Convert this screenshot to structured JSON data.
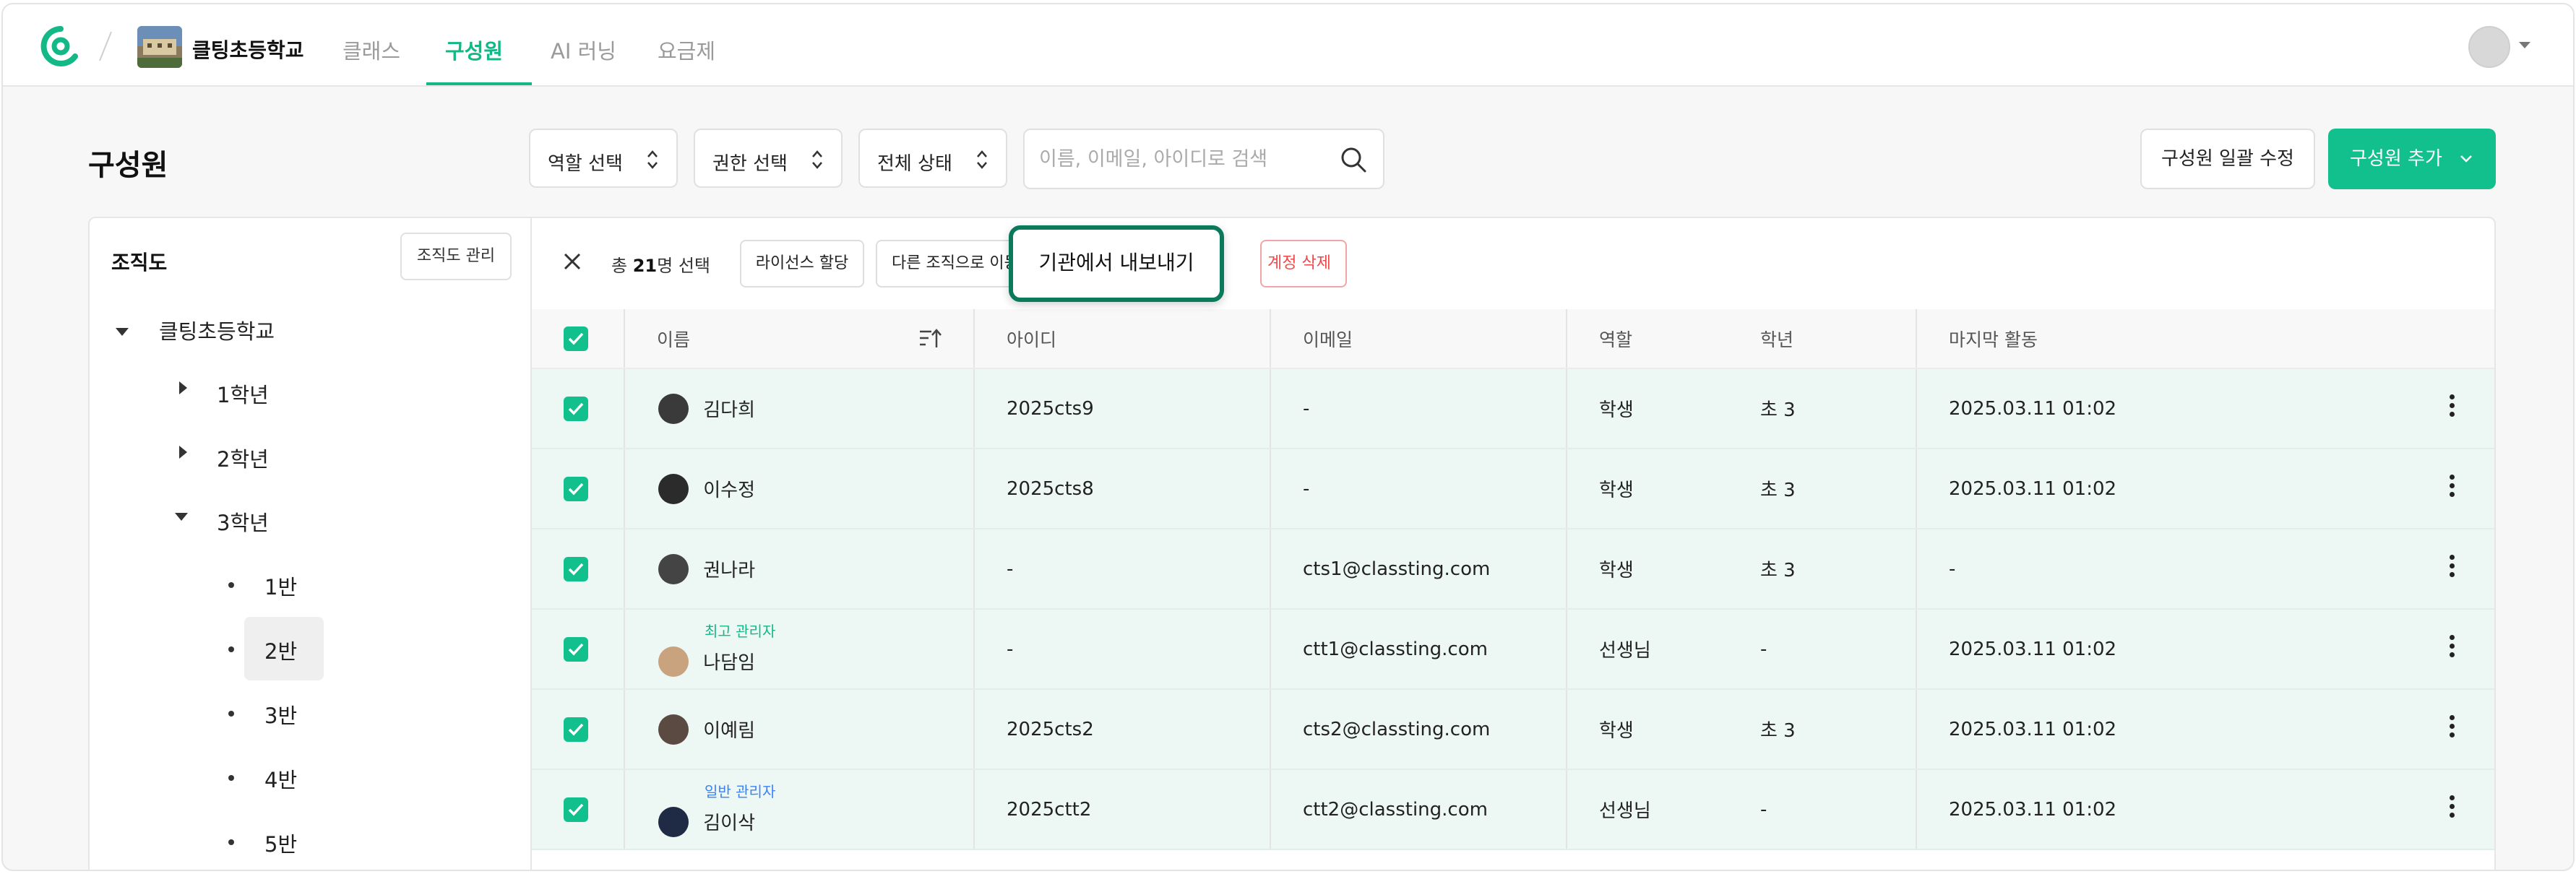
{
  "nav": {
    "school_name": "클팅초등학교",
    "tabs": [
      "클래스",
      "구성원",
      "AI 러닝",
      "요금제"
    ],
    "active_tab": "구성원",
    "accent": "#12b886"
  },
  "header": {
    "title": "구성원",
    "filters": [
      "역할 선택",
      "권한 선택",
      "전체 상태"
    ],
    "search_placeholder": "이름, 이메일, 아이디로 검색",
    "bulk_edit": "구성원 일괄 수정",
    "add_member": "구성원 추가"
  },
  "sidebar": {
    "title": "조직도",
    "manage_button": "조직도 관리",
    "root": "클팅초등학교",
    "grades": [
      "1학년",
      "2학년",
      "3학년"
    ],
    "classes": [
      "1반",
      "2반",
      "3반",
      "4반",
      "5반"
    ],
    "selected_class": "2반"
  },
  "toolbar": {
    "selected_prefix": "총",
    "selected_count": "21",
    "selected_suffix": "명 선택",
    "license_assign": "라이선스 할당",
    "move_org": "다른 조직으로 이동",
    "export_org": "기관에서 내보내기",
    "delete_account": "계정 삭제"
  },
  "table": {
    "headers": [
      "이름",
      "아이디",
      "이메일",
      "역할",
      "학년",
      "마지막 활동"
    ],
    "rows": [
      {
        "role_tag": "",
        "name": "김다희",
        "id": "2025cts9",
        "email": "-",
        "role": "학생",
        "grade": "초 3",
        "last": "2025.03.11 01:02"
      },
      {
        "role_tag": "",
        "name": "이수정",
        "id": "2025cts8",
        "email": "-",
        "role": "학생",
        "grade": "초 3",
        "last": "2025.03.11 01:02"
      },
      {
        "role_tag": "",
        "name": "권나라",
        "id": "-",
        "email": "cts1@classting.com",
        "role": "학생",
        "grade": "초 3",
        "last": "-"
      },
      {
        "role_tag": "최고 관리자",
        "name": "나담임",
        "id": "-",
        "email": "ctt1@classting.com",
        "role": "선생님",
        "grade": "-",
        "last": "2025.03.11 01:02"
      },
      {
        "role_tag": "",
        "name": "이예림",
        "id": "2025cts2",
        "email": "cts2@classting.com",
        "role": "학생",
        "grade": "초 3",
        "last": "2025.03.11 01:02"
      },
      {
        "role_tag": "일반 관리자",
        "name": "김이삭",
        "id": "2025ctt2",
        "email": "ctt2@classting.com",
        "role": "선생님",
        "grade": "-",
        "last": "2025.03.11 01:02"
      }
    ]
  }
}
